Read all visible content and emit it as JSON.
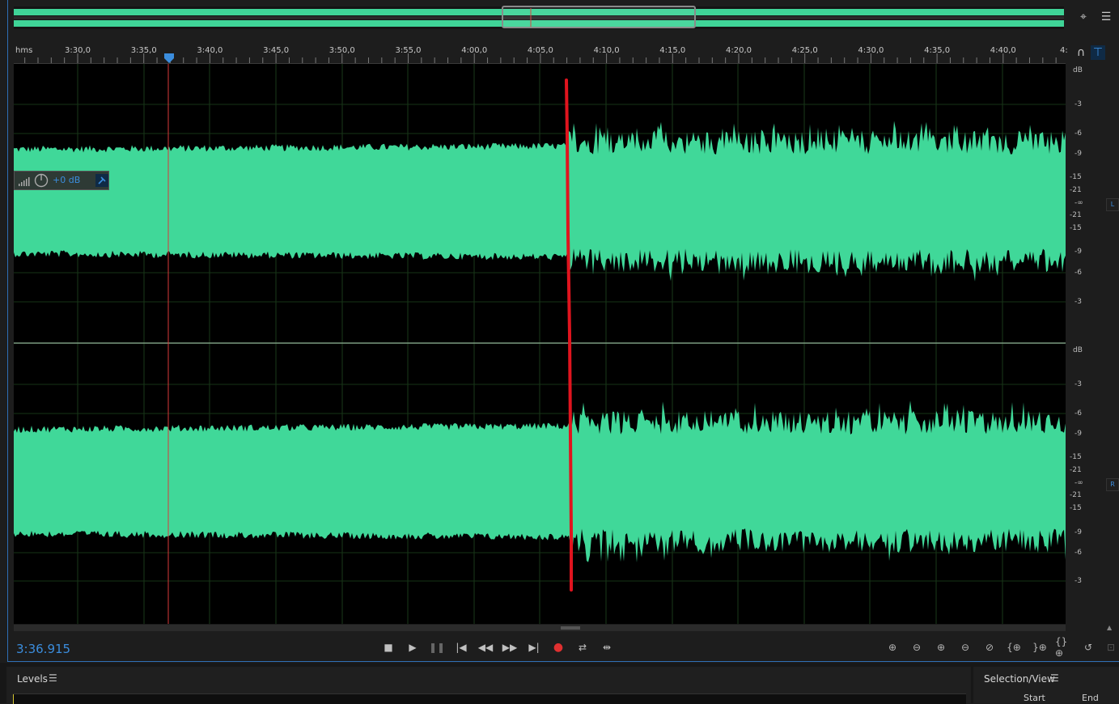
{
  "ruler": {
    "unit": "hms",
    "ticks": [
      "3:30,0",
      "3:35,0",
      "3:40,0",
      "3:45,0",
      "3:50,0",
      "3:55,0",
      "4:00,0",
      "4:05,0",
      "4:10,0",
      "4:15,0",
      "4:20,0",
      "4:25,0",
      "4:30,0",
      "4:35,0",
      "4:40,0",
      "4:"
    ]
  },
  "db_scale": {
    "left": [
      "dB",
      "-3",
      "-6",
      "-9",
      "-15",
      "-21",
      "-∞",
      "-21",
      "-15",
      "-9",
      "-6",
      "-3"
    ],
    "right": [
      "dB",
      "-3",
      "-6",
      "-9",
      "-15",
      "-21",
      "-∞",
      "-21",
      "-15",
      "-9",
      "-6",
      "-3"
    ]
  },
  "channels": {
    "left": "L",
    "right": "R"
  },
  "clip_gain": {
    "value": "+0 dB"
  },
  "transport": {
    "timecode": "3:36.915",
    "buttons": [
      "stop",
      "play",
      "pause",
      "go-to-start",
      "rewind",
      "fast-forward",
      "go-to-end",
      "record",
      "loop",
      "skip-selection"
    ]
  },
  "zoom_buttons": [
    "zoom-in-amplitude",
    "zoom-out-amplitude",
    "zoom-in-time",
    "zoom-out-time",
    "zoom-out-full",
    "zoom-in-at-start",
    "zoom-in-at-end",
    "zoom-to-selection",
    "zoom-history"
  ],
  "levels_panel": {
    "title": "Levels"
  },
  "selection_panel": {
    "title": "Selection/View",
    "col_start": "Start",
    "col_end": "End"
  },
  "colors": {
    "waveform": "#40d899",
    "playhead": "#d93a3a",
    "annotation": "#e0141e",
    "accent": "#3b8ddd"
  }
}
